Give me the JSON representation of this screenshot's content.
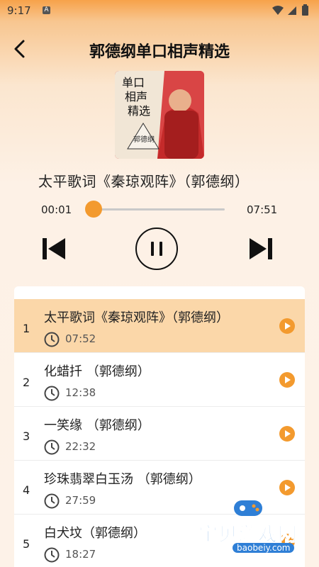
{
  "status": {
    "time": "9:17",
    "a": "A"
  },
  "header": {
    "title": "郭德纲单口相声精选"
  },
  "cover": {
    "line1": "单口",
    "line2": "相声",
    "line3": "精选",
    "fan_text": "郭德纲"
  },
  "player": {
    "track_title": "太平歌词《秦琼观阵》（郭德纲）",
    "current_time": "00:01",
    "total_time": "07:51",
    "progress": 0.002
  },
  "tracks": [
    {
      "index": "1",
      "name": "太平歌词《秦琼观阵》（郭德纲）",
      "duration": "07:52"
    },
    {
      "index": "2",
      "name": "化蜡扦 （郭德纲）",
      "duration": "12:38"
    },
    {
      "index": "3",
      "name": "一笑缘 （郭德纲）",
      "duration": "22:32"
    },
    {
      "index": "4",
      "name": "珍珠翡翠白玉汤 （郭德纲）",
      "duration": "27:59"
    },
    {
      "index": "5",
      "name": "白犬坟（郭德纲）",
      "duration": "18:27"
    }
  ],
  "watermark": {
    "text": "宝贝游戏网",
    "url": "baobeiy.com"
  },
  "colors": {
    "accent": "#f39a2e",
    "active_row": "#fbd7a9"
  }
}
